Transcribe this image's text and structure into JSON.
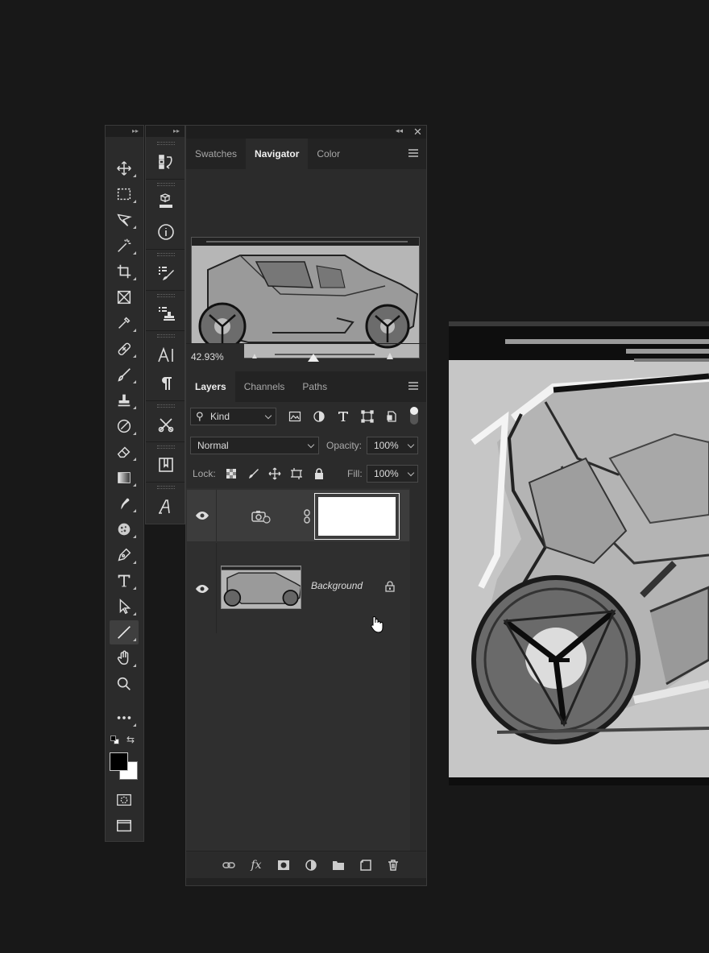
{
  "navigator_panel": {
    "tabs": [
      "Swatches",
      "Navigator",
      "Color"
    ],
    "active_tab": "Navigator",
    "zoom": "42.93%",
    "zoom_slider_value": 0.39
  },
  "layers_panel": {
    "tabs": [
      "Layers",
      "Channels",
      "Paths"
    ],
    "active_tab": "Layers",
    "filter": "Kind",
    "blend_mode": "Normal",
    "opacity_label": "Opacity:",
    "opacity_value": "100%",
    "lock_label": "Lock:",
    "fill_label": "Fill:",
    "fill_value": "100%",
    "layers": [
      {
        "type": "adjustment",
        "name": ""
      },
      {
        "type": "image",
        "name": "Background",
        "locked": true
      }
    ]
  },
  "icons": {
    "tools": [
      "move-icon",
      "marquee-icon",
      "lasso-icon",
      "magic-wand-icon",
      "crop-icon",
      "frame-icon",
      "eyedropper-icon",
      "healing-brush-icon",
      "brush-icon",
      "stamp-icon",
      "history-brush-icon",
      "eraser-icon",
      "gradient-icon",
      "smudge-icon",
      "sponge-icon",
      "pen-icon",
      "type-icon",
      "path-select-icon",
      "line-icon",
      "hand-icon",
      "zoom-icon",
      "more-tools-icon"
    ],
    "dock": [
      "history-icon",
      "3d-icon",
      "info-icon",
      "brush-settings-icon",
      "clone-source-icon",
      "character-icon",
      "paragraph-icon",
      "tool-presets-icon",
      "libraries-icon",
      "glyphs-icon"
    ]
  },
  "colors": {
    "foreground": "#000000",
    "background": "#ffffff"
  }
}
